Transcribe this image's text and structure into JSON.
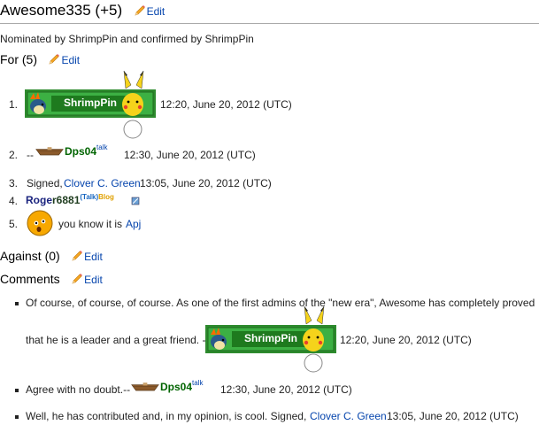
{
  "title": "Awesome335 (+5)",
  "edit_label": "Edit",
  "nominated": "Nominated by ShrimpPin and confirmed by ShrimpPin",
  "for_section": {
    "heading": "For (5)",
    "items": [
      {
        "num": "1.",
        "banner_text": "ShrimpPin",
        "timestamp": "12:20, June 20, 2012 (UTC)"
      },
      {
        "num": "2.",
        "prefix": "--",
        "user": "Dps04",
        "talk": "talk",
        "timestamp": "12:30, June 20, 2012 (UTC)"
      },
      {
        "num": "3.",
        "prefix": "Signed,",
        "user": "Clover C. Green",
        "timestamp": "13:05, June 20, 2012 (UTC)"
      },
      {
        "num": "4.",
        "user_a": "Roge",
        "user_b": "r6881",
        "talk": "(Talk)",
        "blog": "Blog"
      },
      {
        "num": "5.",
        "text": "you know it is",
        "user": "Apj"
      }
    ]
  },
  "against_section": {
    "heading": "Against (0)"
  },
  "comments_section": {
    "heading": "Comments",
    "items": [
      {
        "line1": "Of course, of course, of course. As one of the first admins of the \"new era\", Awesome has completely proved",
        "line2": "that he is a leader and a great friend. -",
        "banner_text": "ShrimpPin",
        "timestamp": "12:20, June 20, 2012 (UTC)"
      },
      {
        "text": "Agree with no doubt.--",
        "user": "Dps04",
        "talk": "talk",
        "timestamp": "12:30, June 20, 2012 (UTC)"
      },
      {
        "text": "Well, he has contributed and, in my opinion, is cool. Signed,",
        "user": "Clover C. Green",
        "timestamp": "13:05, June 20, 2012 (UTC)"
      }
    ]
  },
  "colors": {
    "link": "#0645ad",
    "green": "#006400",
    "banner_green": "#2e9e2e"
  }
}
